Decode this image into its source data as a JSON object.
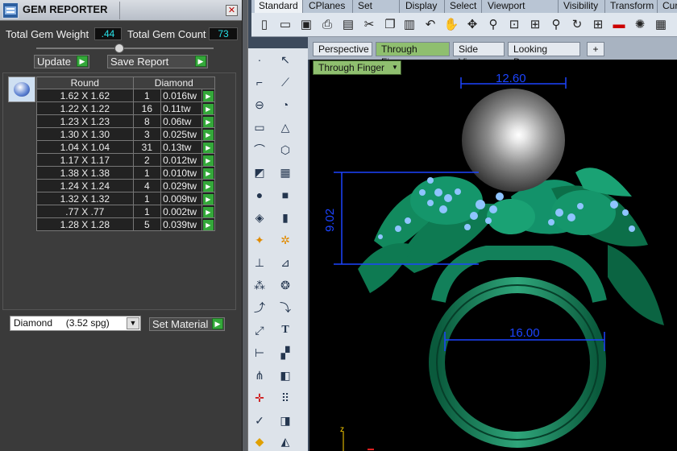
{
  "gem_reporter": {
    "title": "GEM REPORTER",
    "close_glyph": "✕",
    "total_weight_label": "Total Gem Weight",
    "total_weight_value": ".44",
    "total_count_label": "Total Gem Count",
    "total_count_value": "73",
    "update_label": "Update",
    "save_report_label": "Save Report",
    "table_headers": [
      "Round",
      "Diamond"
    ],
    "rows": [
      {
        "size": "1.62 X 1.62",
        "count": "1",
        "weight": "0.016tw"
      },
      {
        "size": "1.22 X 1.22",
        "count": "16",
        "weight": "0.11tw"
      },
      {
        "size": "1.23 X 1.23",
        "count": "8",
        "weight": "0.06tw"
      },
      {
        "size": "1.30 X 1.30",
        "count": "3",
        "weight": "0.025tw"
      },
      {
        "size": "1.04 X 1.04",
        "count": "31",
        "weight": "0.13tw"
      },
      {
        "size": "1.17 X 1.17",
        "count": "2",
        "weight": "0.012tw"
      },
      {
        "size": "1.38 X 1.38",
        "count": "1",
        "weight": "0.010tw"
      },
      {
        "size": "1.24 X 1.24",
        "count": "4",
        "weight": "0.029tw"
      },
      {
        "size": "1.32 X 1.32",
        "count": "1",
        "weight": "0.009tw"
      },
      {
        "size": ".77 X .77",
        "count": "1",
        "weight": "0.002tw"
      },
      {
        "size": "1.28 X 1.28",
        "count": "5",
        "weight": "0.039tw"
      }
    ],
    "material_value": "Diamond     (3.52 spg)",
    "set_material_label": "Set Material"
  },
  "rhino": {
    "menu_tabs": [
      "Standard",
      "CPlanes",
      "Set View",
      "Display",
      "Select",
      "Viewport Layout",
      "Visibility",
      "Transform",
      "Cur"
    ],
    "viewport_tabs": [
      "Perspective",
      "Through Finger",
      "Side View",
      "Looking Down",
      "+"
    ],
    "viewport_label": "Through Finger",
    "dimensions": {
      "top_width": "12.60",
      "height": "9.02",
      "ring_width": "16.00"
    },
    "axis_label": "z"
  },
  "colors": {
    "accent_green": "#34a83a",
    "dimension_blue": "#1c44ff",
    "ring_green": "#0f6b4a",
    "value_cyan": "#27e2e8"
  }
}
